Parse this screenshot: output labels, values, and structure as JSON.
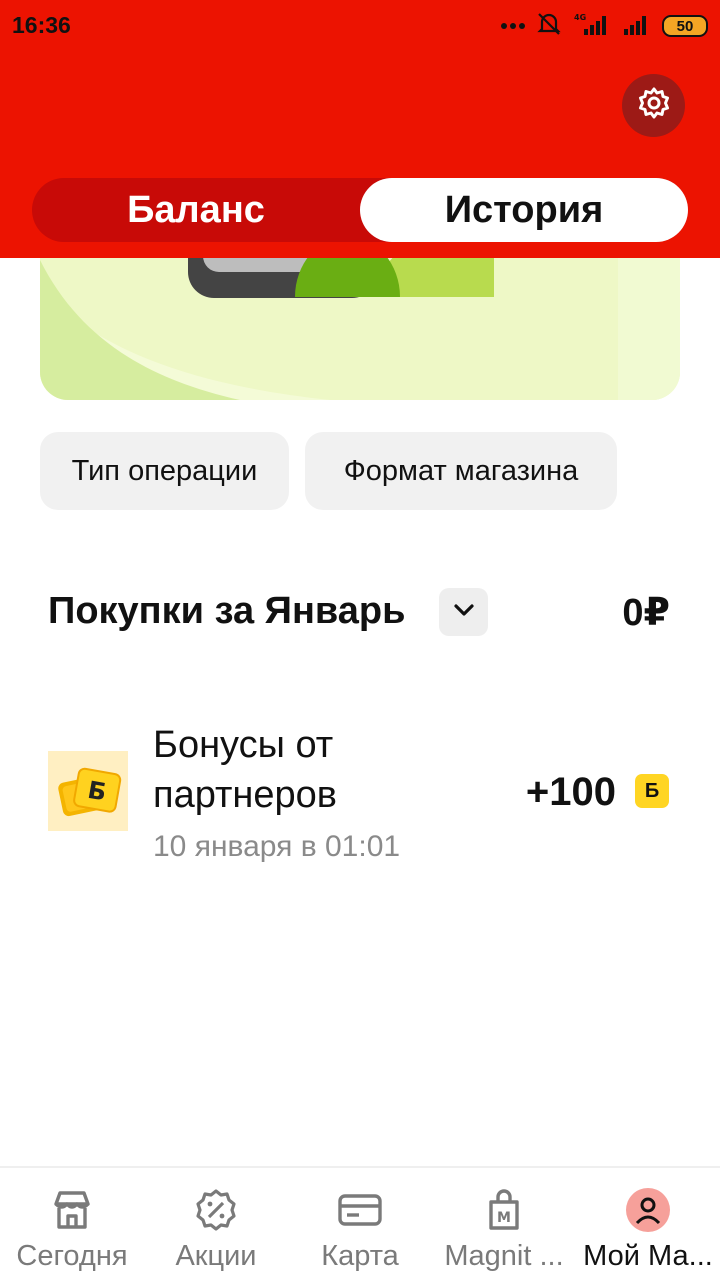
{
  "status_bar": {
    "time": "16:36",
    "network": "4G",
    "battery": "50"
  },
  "header": {
    "settings_icon": "gear-icon",
    "tabs": [
      {
        "label": "Баланс",
        "active": false
      },
      {
        "label": "История",
        "active": true
      }
    ]
  },
  "filters": [
    {
      "label": "Тип операции"
    },
    {
      "label": "Формат магазина"
    }
  ],
  "month": {
    "title": "Покупки за Январь",
    "toggle_icon": "chevron-down-icon",
    "total": "0₽"
  },
  "transactions": [
    {
      "title": "Бонусы от партнеров",
      "date": "10 января в 01:01",
      "amount": "+100",
      "currency_badge": "Б",
      "icon": "bonus-coins-icon"
    }
  ],
  "bottom_nav": [
    {
      "label": "Сегодня",
      "icon": "store-icon",
      "active": false
    },
    {
      "label": "Акции",
      "icon": "percent-badge-icon",
      "active": false
    },
    {
      "label": "Карта",
      "icon": "card-icon",
      "active": false
    },
    {
      "label": "Magnit ...",
      "icon": "shopping-bag-icon",
      "active": false
    },
    {
      "label": "Мой Ма...",
      "icon": "profile-icon",
      "active": true
    }
  ],
  "colors": {
    "brand_red": "#ec1301",
    "segment_bg": "#c80a07",
    "settings_bg": "#9d1a16",
    "bonus_yellow": "#ffd523",
    "chip_bg": "#f1f1f1"
  }
}
